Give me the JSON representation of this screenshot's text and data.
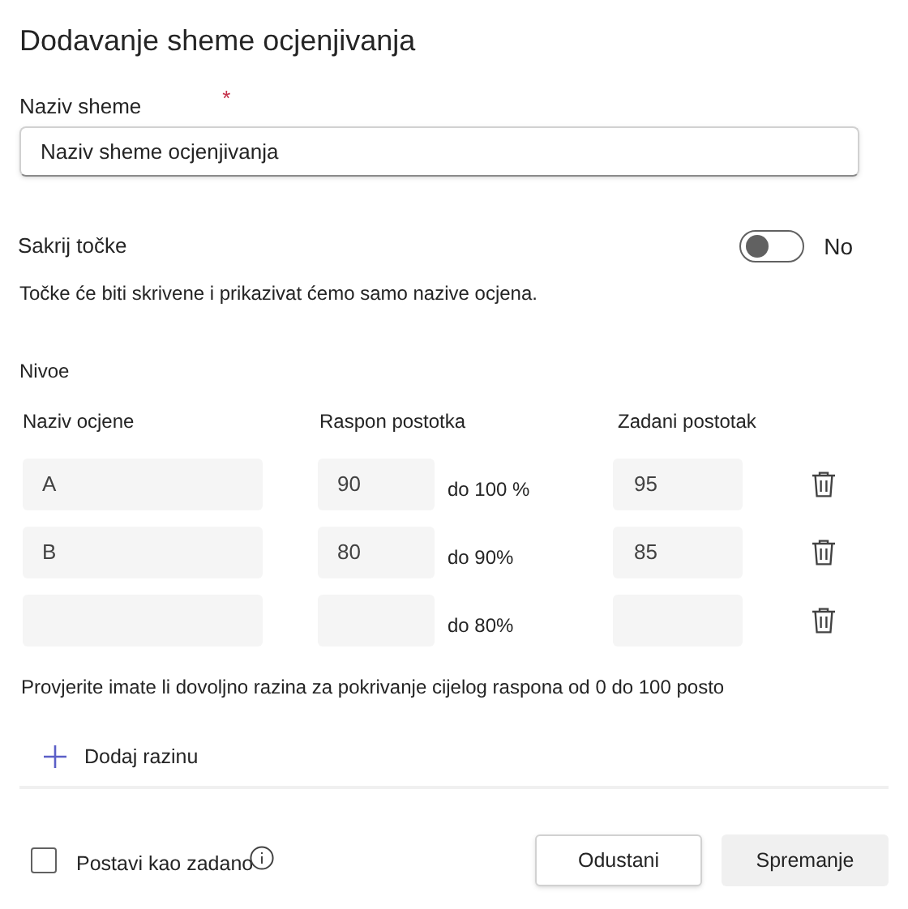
{
  "title": "Dodavanje sheme ocjenjivanja",
  "name_field": {
    "label": "Naziv sheme",
    "required_mark": "*",
    "value": "Naziv sheme ocjenjivanja"
  },
  "hide_points": {
    "label": "Sakrij točke",
    "on": false,
    "state_label": "No",
    "description": "Točke će biti skrivene i prikazivat ćemo samo nazive ocjena."
  },
  "levels": {
    "title": "Nivoe",
    "columns": [
      "Naziv ocjene",
      "Raspon postotka",
      "Zadani postotak"
    ],
    "rows": [
      {
        "grade": "A",
        "range_from": "90",
        "range_to": "do 100 %",
        "default": "95"
      },
      {
        "grade": "B",
        "range_from": "80",
        "range_to": "do 90%",
        "default": "85"
      },
      {
        "range_to": "do 80%"
      }
    ],
    "note": "Provjerite imate li dovoljno razina za pokrivanje cijelog raspona od 0 do 100 posto",
    "add_button": "Dodaj razinu"
  },
  "set_default": {
    "label": "Postavi kao zadano",
    "checked": false
  },
  "buttons": [
    "Odustani",
    "Spremanje"
  ]
}
